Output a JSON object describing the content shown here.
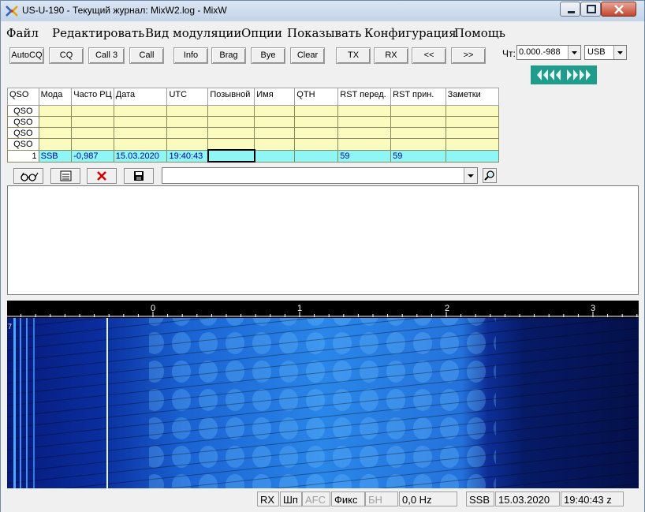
{
  "window": {
    "title": "US-U-190 - Текущий журнал: MixW2.log - MixW"
  },
  "menu": [
    "Файл",
    "Редактировать",
    "Вид модуляции",
    "Опции",
    "Показывать",
    "Конфигурация",
    "Помощь"
  ],
  "toolbar": {
    "buttons": [
      "AutoCQ",
      "CQ",
      "Call 3",
      "Call",
      "Info",
      "Brag",
      "Bye",
      "Clear",
      "TX",
      "RX",
      "<<",
      ">>"
    ]
  },
  "freq_panel": {
    "label": "Чт:",
    "freq_value": "0.000.-988",
    "mode_value": "USB"
  },
  "log": {
    "headers": [
      "QSO",
      "Мода",
      "Часто РЦ",
      "Дата",
      "UTC",
      "Позывной",
      "Имя",
      "QTH",
      "RST перед.",
      "RST прин.",
      "Заметки"
    ],
    "previous_rows": [
      "QSO",
      "QSO",
      "QSO",
      "QSO"
    ],
    "active_row": {
      "num": "1",
      "mode": "SSB",
      "freq": "-0,987",
      "date": "15.03.2020",
      "utc": "19:40:43",
      "call": "",
      "name": "",
      "qth": "",
      "rst_sent": "59",
      "rst_rcvd": "59",
      "notes": ""
    }
  },
  "mini_toolbar": {
    "icons": [
      "glasses-icon",
      "log-icon",
      "delete-icon",
      "save-icon"
    ],
    "search_value": ""
  },
  "waterfall": {
    "scale_labels": [
      "0",
      "1",
      "2",
      "3"
    ],
    "left_mark": "7"
  },
  "status": {
    "rx": "RX",
    "shp": "Шп",
    "afc": "AFC",
    "fix": "Фикс",
    "bn": "БН",
    "offset": "0,0 Hz",
    "mode": "SSB",
    "date": "15.03.2020",
    "time": "19:40:43 z"
  }
}
